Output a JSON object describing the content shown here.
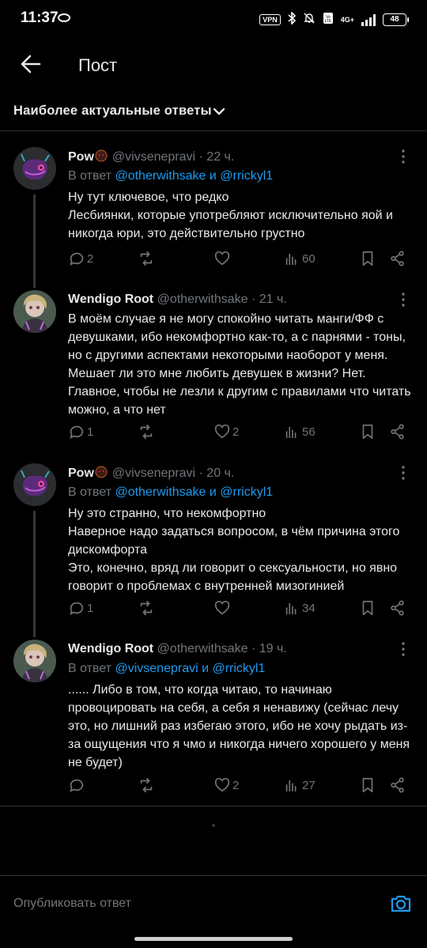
{
  "status_bar": {
    "time": "11:37",
    "vpn": "VPN",
    "network": "4G+",
    "battery": "48"
  },
  "header": {
    "title": "Пост"
  },
  "sort": {
    "label": "Наиболее актуальные ответы"
  },
  "replies": [
    {
      "name": "Pow",
      "handle": "@vivsenepravi",
      "time": "· 22 ч.",
      "reply_prefix": "В ответ",
      "mentions": "@otherwithsake и @rrickyl1",
      "text": "Ну тут ключевое, что редко\nЛесбиянки, которые употребляют исключительно яой и никогда юри, это действительно грустно",
      "replies": "2",
      "reposts": "",
      "likes": "",
      "views": "60"
    },
    {
      "name": "Wendigo Root",
      "handle": "@otherwithsake",
      "time": "· 21 ч.",
      "text": "В моём случае я не могу спокойно читать манги/ФФ с девушками, ибо некомфортно как-то, а с парнями - тоны, но с другими аспектами некоторыми наоборот у меня. Мешает ли это мне любить девушек в жизни? Нет. Главное, чтобы не лезли к другим с правилами что читать можно, а что нет",
      "replies": "1",
      "reposts": "",
      "likes": "2",
      "views": "56"
    },
    {
      "name": "Pow",
      "handle": "@vivsenepravi",
      "time": "· 20 ч.",
      "reply_prefix": "В ответ",
      "mentions": "@otherwithsake и @rrickyl1",
      "text": "Ну это странно, что некомфортно\nНаверное надо задаться вопросом, в чём причина этого дискомфорта\nЭто, конечно, вряд ли говорит о сексуальности, но явно говорит о проблемах с внутренней мизогинией",
      "replies": "1",
      "reposts": "",
      "likes": "",
      "views": "34"
    },
    {
      "name": "Wendigo Root",
      "handle": "@otherwithsake",
      "time": "· 19 ч.",
      "reply_prefix": "В ответ",
      "mentions": "@vivsenepravi и @rrickyl1",
      "text": "...... Либо в том, что когда читаю, то начинаю провоцировать на себя, а себя я ненавижу (сейчас лечу это, но лишний раз избегаю этого, ибо не хочу рыдать из-за ощущения что я чмо и никогда ничего хорошего у меня не будет)",
      "replies": "",
      "reposts": "",
      "likes": "2",
      "views": "27"
    }
  ],
  "compose": {
    "placeholder": "Опубликовать ответ"
  },
  "colors": {
    "background": "#000000",
    "text": "#e7e9ea",
    "secondary": "#71767b",
    "accent": "#1d9bf0",
    "divider": "#2f3336"
  }
}
